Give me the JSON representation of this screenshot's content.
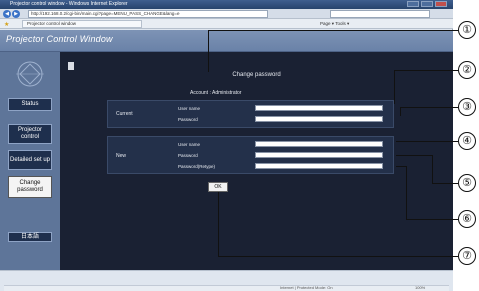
{
  "browser": {
    "window_title": "Projector control window - Windows Internet Explorer",
    "url": "http://192.168.0.2/cgi-bin/main.cgi?page=MENU_PASS_CHANGE&lang=e",
    "tab_title": "Projector control window",
    "toolbar_tools": "Page ▾  Tools ▾",
    "status_zone": "Internet | Protected Mode: On",
    "zoom": "100%"
  },
  "app": {
    "title": "Projector Control Window"
  },
  "sidebar": {
    "items": [
      {
        "label": "Status",
        "active": false
      },
      {
        "label": "Projector control",
        "active": false
      },
      {
        "label": "Detailed set up",
        "active": false
      },
      {
        "label": "Change password",
        "active": true
      },
      {
        "label": "日本語",
        "active": false
      }
    ]
  },
  "page": {
    "heading": "Change password",
    "account_label": "Account :",
    "account_value": "Administrator",
    "current_label": "Current",
    "new_label": "New",
    "fields": {
      "current_username": "User name",
      "current_password": "Password",
      "new_username": "User name",
      "new_password": "Password",
      "new_password_retype": "Password(Retype)"
    },
    "ok_label": "OK"
  },
  "callouts": [
    "①",
    "②",
    "③",
    "④",
    "⑤",
    "⑥",
    "⑦"
  ]
}
